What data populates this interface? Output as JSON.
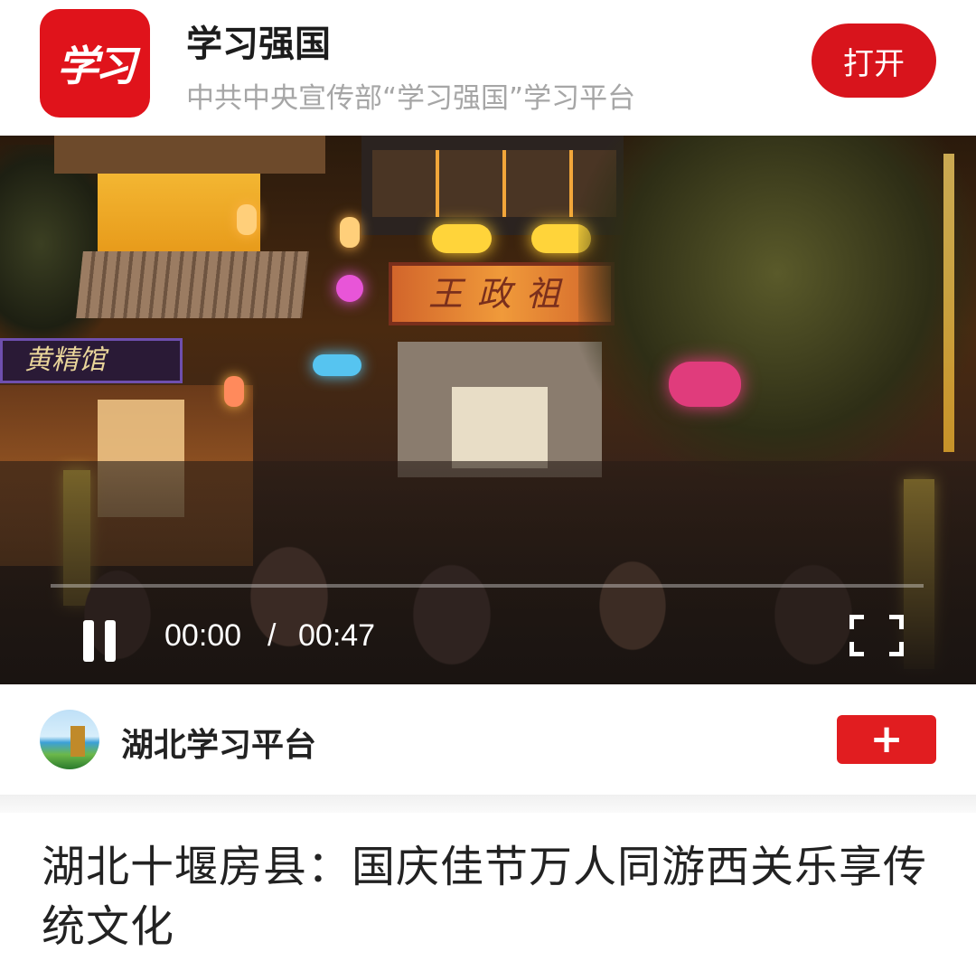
{
  "app_banner": {
    "logo_text": "学习",
    "app_name": "学习强国",
    "description": "中共中央宣传部“学习强国”学习平台",
    "open_label": "打开"
  },
  "video": {
    "scene_sign_left": "黄精馆",
    "scene_plaque": "王政祖",
    "current_time": "00:00",
    "separator": "/",
    "duration": "00:47",
    "progress": 0
  },
  "channel": {
    "name": "湖北学习平台",
    "follow_label": "+"
  },
  "article": {
    "title": "湖北十堰房县：国庆佳节万人同游西关乐享传统文化"
  },
  "colors": {
    "brand_red": "#d8141c",
    "follow_red": "#e11d20",
    "muted_text": "#a6a6a6"
  }
}
